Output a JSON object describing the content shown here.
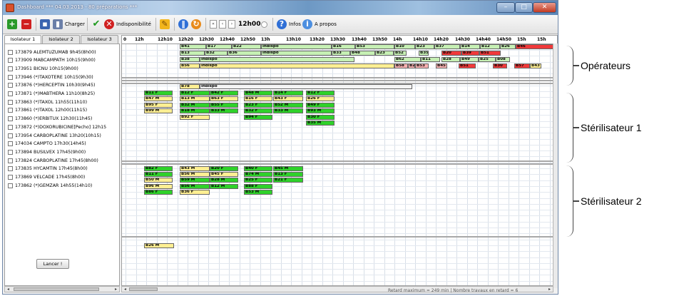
{
  "window": {
    "title": "Dashboard *** 04.03.2013 - 80 préparations ***",
    "minimize_glyph": "–",
    "maximize_glyph": "□",
    "close_glyph": "✕"
  },
  "toolbar": {
    "charger": "Charger",
    "indisponibilite": "Indisponibilité",
    "time": "12h00",
    "infos": "Infos",
    "a_propos": "A propos"
  },
  "tabs": [
    "Isolateur 1",
    "Isolateur 2",
    "Isolateur 3"
  ],
  "preparations": [
    "173879 ALEMTUZUMAB 9h45(8h00)",
    "173909 MABCAMPATH 10h15(9h00)",
    "173951 BICNU 10h15(9h00)",
    "173946 (*)TAXOTERE 10h15(9h30)",
    "173876 (*)HERCEPTIN 10h30(9h45)",
    "173871 (*)MABTHERA 11h10(8h25)",
    "173863 (*)TAXOL 11h55(11h10)",
    "173861 (*)TAXOL 12h00(11h15)",
    "173860 (*)ERBITUX 12h30(11h45)",
    "173872 (*)DOXORUBICINE[Pecho] 12h15",
    "173954 CARBOPLATINE 13h20(10h15)",
    "174034 CAMPTO 17h30(14h45)",
    "173894 BUSILVEX 17h45(9h00)",
    "173824 CARBOPLATINE 17h45(8h00)",
    "173835 HYCAMTIN 17h45(8h00)",
    "173869 VELCADE 17h45(8h00)",
    "173862 (*)GEMZAR 14h55(14h10)"
  ],
  "launch_button": "Lancer !",
  "timeline": [
    "0",
    "12h",
    "12h10",
    "12h20",
    "12h30",
    "12h40",
    "12h50",
    "13h",
    "13h10",
    "13h20",
    "13h30",
    "13h40",
    "13h50",
    "14h",
    "14h10",
    "14h20",
    "14h30",
    "14h40",
    "14h50",
    "15h",
    "15h"
  ],
  "tasks": [
    {
      "label": "B41",
      "color": "#c6f0b4"
    },
    {
      "label": "B17",
      "color": "#c6f0b4"
    },
    {
      "label": "B22",
      "color": "#c6f0b4"
    },
    {
      "label": "indispo",
      "color": "#c6f0b4"
    },
    {
      "label": "B16",
      "color": "#c6f0b4"
    },
    {
      "label": "B53",
      "color": "#c6f0b4"
    },
    {
      "label": "B10",
      "color": "#c6f0b4"
    },
    {
      "label": "B23",
      "color": "#c6f0b4"
    },
    {
      "label": "B37",
      "color": "#c6f0b4"
    },
    {
      "label": "B14",
      "color": "#c6f0b4"
    },
    {
      "label": "B12",
      "color": "#c6f0b4"
    },
    {
      "label": "B26",
      "color": "#c6f0b4"
    },
    {
      "label": "B46",
      "color": "#f0393a"
    },
    {
      "label": "B13",
      "color": "#c6f0b4"
    },
    {
      "label": "B32",
      "color": "#c6f0b4"
    },
    {
      "label": "B36",
      "color": "#c6f0b4"
    },
    {
      "label": "indispo",
      "color": "#c6f0b4"
    },
    {
      "label": "B33",
      "color": "#c6f0b4"
    },
    {
      "label": "B48",
      "color": "#c6f0b4"
    },
    {
      "label": "B23",
      "color": "#c6f0b4"
    },
    {
      "label": "B52",
      "color": "#c6f0b4"
    },
    {
      "label": "B35",
      "color": "#c6f0b4"
    },
    {
      "label": "B20",
      "color": "#f0393a"
    },
    {
      "label": "B39",
      "color": "#f0393a"
    },
    {
      "label": "B51",
      "color": "#f0393a"
    },
    {
      "label": "B38",
      "color": "#c6f0b4"
    },
    {
      "label": "indispo",
      "color": "#c6f0b4"
    },
    {
      "label": "B62",
      "color": "#c6f0b4"
    },
    {
      "label": "B11",
      "color": "#c6f0b4"
    },
    {
      "label": "B28",
      "color": "#c6f0b4"
    },
    {
      "label": "B49",
      "color": "#c6f0b4"
    },
    {
      "label": "B25",
      "color": "#c6f0b4"
    },
    {
      "label": "B08",
      "color": "#c6f0b4"
    },
    {
      "label": "B56",
      "color": "#ffef93"
    },
    {
      "label": "indispo",
      "color": "#ffef93"
    },
    {
      "label": "B58",
      "color": "#f7b0b0"
    },
    {
      "label": "B20",
      "color": "#f7b0b0"
    },
    {
      "label": "B53",
      "color": "#f7b0b0"
    },
    {
      "label": "B45",
      "color": "#f7b0b0"
    },
    {
      "label": "B51",
      "color": "#f0393a"
    },
    {
      "label": "B30",
      "color": "#f0393a"
    },
    {
      "label": "B57",
      "color": "#f0393a"
    },
    {
      "label": "B43",
      "color": "#ffef93"
    },
    {
      "label": "B78",
      "color": "#ffef93"
    },
    {
      "label": "indispo",
      "color": "#f4f4f4"
    },
    {
      "label": "B11 F",
      "color": "#2fd12a"
    },
    {
      "label": "B12 F",
      "color": "#2fd12a"
    },
    {
      "label": "B42 F",
      "color": "#2fd12a"
    },
    {
      "label": "B48 M",
      "color": "#2fd12a"
    },
    {
      "label": "B14 F",
      "color": "#2fd12a"
    },
    {
      "label": "B12 F",
      "color": "#2fd12a"
    },
    {
      "label": "B47 M",
      "color": "#ffef93"
    },
    {
      "label": "B13 M",
      "color": "#ffef93"
    },
    {
      "label": "B63 F",
      "color": "#ffef93"
    },
    {
      "label": "B16 F",
      "color": "#ffef93"
    },
    {
      "label": "B43 F",
      "color": "#ffef93"
    },
    {
      "label": "B26 F",
      "color": "#ffef93"
    },
    {
      "label": "B95 F",
      "color": "#ffef93"
    },
    {
      "label": "B32 M",
      "color": "#2fd12a"
    },
    {
      "label": "B55 F",
      "color": "#2fd12a"
    },
    {
      "label": "B23 F",
      "color": "#2fd12a"
    },
    {
      "label": "B52 M",
      "color": "#2fd12a"
    },
    {
      "label": "B49 F",
      "color": "#2fd12a"
    },
    {
      "label": "B99 M",
      "color": "#ffef93"
    },
    {
      "label": "B18 M",
      "color": "#2fd12a"
    },
    {
      "label": "B33 M",
      "color": "#2fd12a"
    },
    {
      "label": "B32 F",
      "color": "#2fd12a"
    },
    {
      "label": "B33 M",
      "color": "#2fd12a"
    },
    {
      "label": "B93 M",
      "color": "#2fd12a"
    },
    {
      "label": "B92 F",
      "color": "#ffef93"
    },
    {
      "label": "B94 F",
      "color": "#2fd12a"
    },
    {
      "label": "B30 F",
      "color": "#2fd12a"
    },
    {
      "label": "B35 M",
      "color": "#2fd12a"
    },
    {
      "label": "B82 F",
      "color": "#2fd12a"
    },
    {
      "label": "B43 M",
      "color": "#ffef93"
    },
    {
      "label": "B20 F",
      "color": "#2fd12a"
    },
    {
      "label": "B40 F",
      "color": "#2fd12a"
    },
    {
      "label": "B45 M",
      "color": "#2fd12a"
    },
    {
      "label": "B11 F",
      "color": "#2fd12a"
    },
    {
      "label": "B56 M",
      "color": "#ffef93"
    },
    {
      "label": "B45 F",
      "color": "#ffef93"
    },
    {
      "label": "B74 M",
      "color": "#2fd12a"
    },
    {
      "label": "B13 F",
      "color": "#2fd12a"
    },
    {
      "label": "B50 M",
      "color": "#ffef93"
    },
    {
      "label": "B59 M",
      "color": "#2fd12a"
    },
    {
      "label": "B28 M",
      "color": "#2fd12a"
    },
    {
      "label": "B25 F",
      "color": "#2fd12a"
    },
    {
      "label": "B21 F",
      "color": "#2fd12a"
    },
    {
      "label": "B96 M",
      "color": "#ffef93"
    },
    {
      "label": "B56 M",
      "color": "#2fd12a"
    },
    {
      "label": "B12 M",
      "color": "#2fd12a"
    },
    {
      "label": "B88 F",
      "color": "#2fd12a"
    },
    {
      "label": "B86 F",
      "color": "#2fd12a"
    },
    {
      "label": "B36 F",
      "color": "#ffef93"
    },
    {
      "label": "B53 M",
      "color": "#2fd12a"
    },
    {
      "label": "B26 M",
      "color": "#ffef93"
    }
  ],
  "status": "Retard maximum = 249 min  |  Nombre travaux en retard = 6",
  "annotations": [
    "Opérateurs",
    "Stérilisateur 1",
    "Stérilisateur 2"
  ]
}
